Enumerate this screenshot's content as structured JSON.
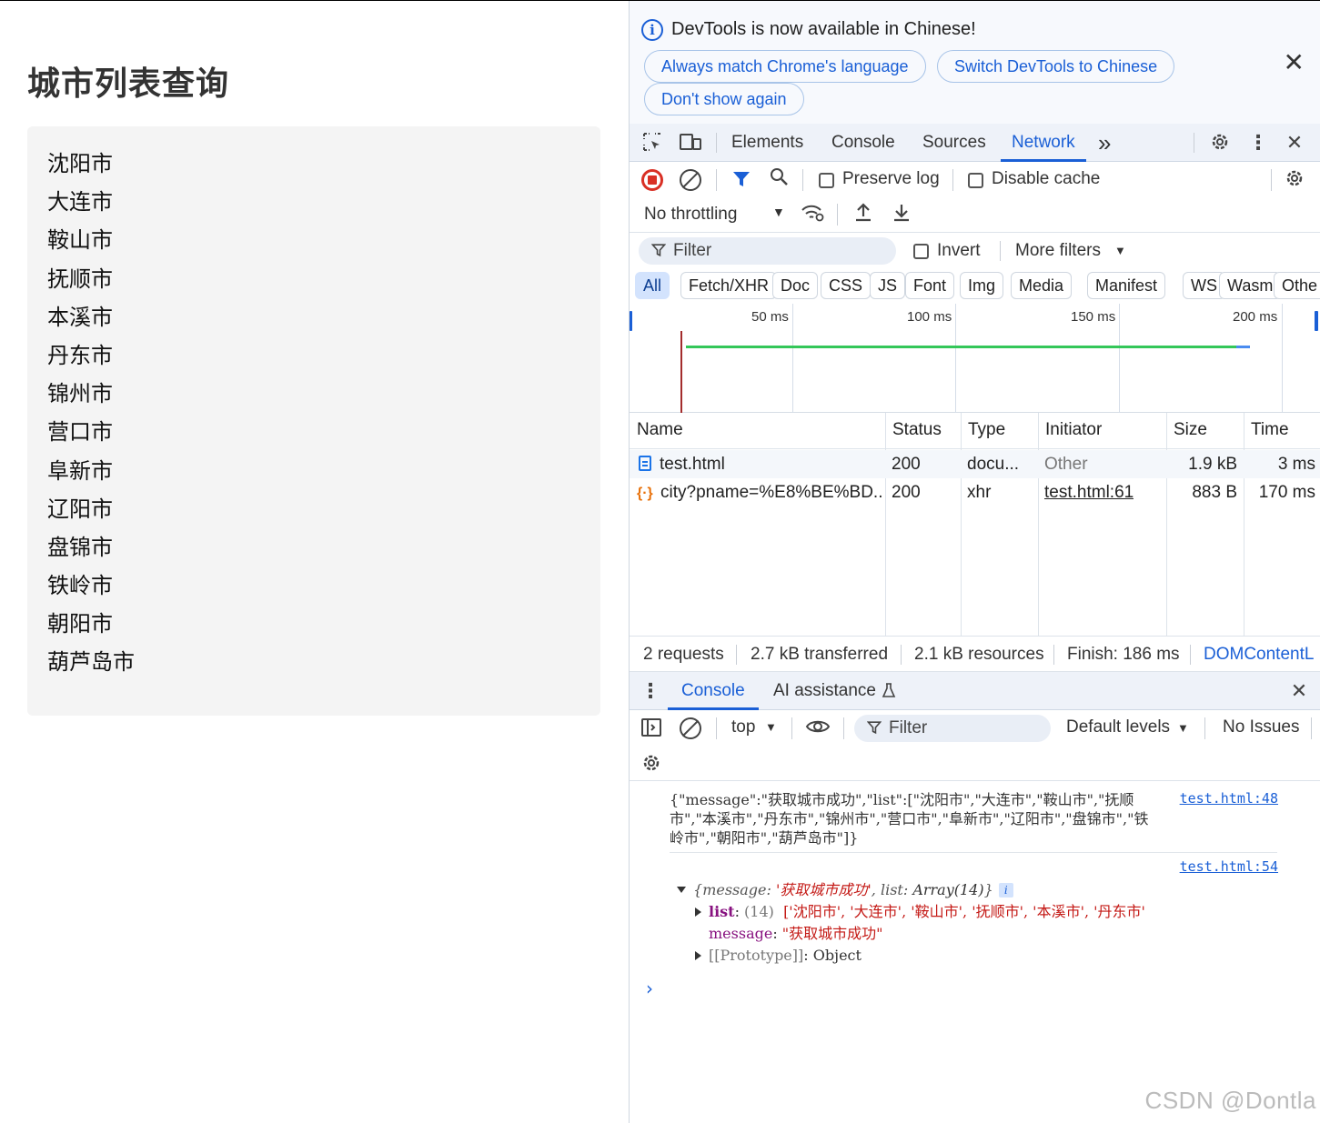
{
  "page": {
    "title": "城市列表查询",
    "cities": [
      "沈阳市",
      "大连市",
      "鞍山市",
      "抚顺市",
      "本溪市",
      "丹东市",
      "锦州市",
      "营口市",
      "阜新市",
      "辽阳市",
      "盘锦市",
      "铁岭市",
      "朝阳市",
      "葫芦岛市"
    ]
  },
  "devtools": {
    "infobar": {
      "message": "DevTools is now available in Chinese!",
      "btn_match": "Always match Chrome's language",
      "btn_switch": "Switch DevTools to Chinese",
      "btn_dont_show": "Don't show again",
      "close": "✕"
    },
    "tabs": [
      "Elements",
      "Console",
      "Sources",
      "Network"
    ],
    "more_tabs": "»",
    "toolbar": {
      "preserve_log": "Preserve log",
      "disable_cache": "Disable cache",
      "throttling": "No throttling"
    },
    "filter": {
      "placeholder": "Filter",
      "invert": "Invert",
      "more_filters": "More filters"
    },
    "types": [
      "All",
      "Fetch/XHR",
      "Doc",
      "CSS",
      "JS",
      "Font",
      "Img",
      "Media",
      "Manifest",
      "WS",
      "Wasm",
      "Othe"
    ],
    "timeline_labels": [
      "50 ms",
      "100 ms",
      "150 ms",
      "200 ms"
    ],
    "table": {
      "headers": [
        "Name",
        "Status",
        "Type",
        "Initiator",
        "Size",
        "Time"
      ],
      "rows": [
        {
          "name": "test.html",
          "status": "200",
          "type": "docu...",
          "initiator": "Other",
          "size": "1.9 kB",
          "time": "3 ms"
        },
        {
          "name": "city?pname=%E8%BE%BD...",
          "status": "200",
          "type": "xhr",
          "initiator": "test.html:61",
          "size": "883 B",
          "time": "170 ms"
        }
      ]
    },
    "summary": {
      "requests": "2 requests",
      "transferred": "2.7 kB transferred",
      "resources": "2.1 kB resources",
      "finish": "Finish: 186 ms",
      "dom": "DOMContentL"
    },
    "drawer": {
      "tab_console": "Console",
      "tab_ai": "AI assistance",
      "context": "top",
      "filter": "Filter",
      "levels": "Default levels",
      "issues": "No Issues"
    },
    "console": {
      "log1_text": "{\"message\":\"获取城市成功\",\"list\":[\"沈阳市\",\"大连市\",\"鞍山市\",\"抚顺市\",\"本溪市\",\"丹东市\",\"锦州市\",\"营口市\",\"阜新市\",\"辽阳市\",\"盘锦市\",\"铁岭市\",\"朝阳市\",\"葫芦岛市\"]}",
      "log1_link": "test.html:48",
      "log2_link": "test.html:54",
      "obj_summary_key1": "message",
      "obj_summary_val1": "'获取城市成功'",
      "obj_summary_key2": "list",
      "obj_summary_val2": "Array(14)",
      "list_key": "list",
      "list_count": "(14)",
      "list_preview": "['沈阳市', '大连市', '鞍山市', '抚顺市', '本溪市', '丹东市'",
      "message_key": "message",
      "message_val": "\"获取城市成功\"",
      "proto_key": "[[Prototype]]",
      "proto_val": "Object"
    }
  },
  "watermark": "CSDN @Dontla"
}
